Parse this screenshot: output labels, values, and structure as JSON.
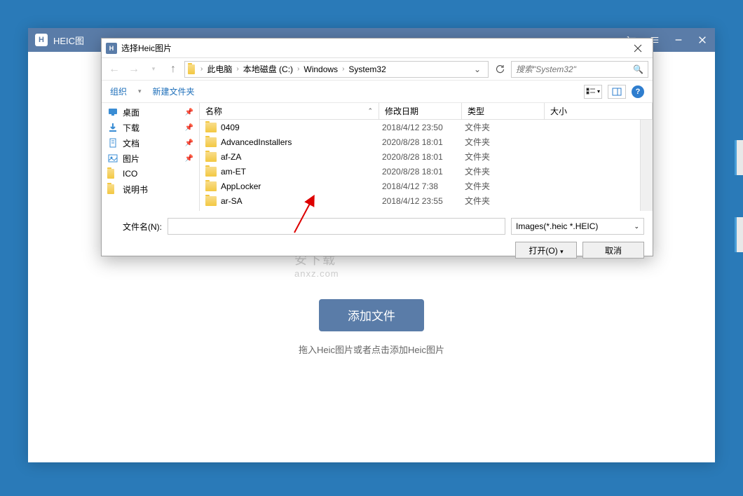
{
  "app": {
    "title": "HEIC图",
    "add_button": "添加文件",
    "hint": "拖入Heic图片或者点击添加Heic图片"
  },
  "watermark": {
    "text": "安下载",
    "url": "anxz.com"
  },
  "dialog": {
    "title": "选择Heic图片",
    "breadcrumb": [
      "此电脑",
      "本地磁盘 (C:)",
      "Windows",
      "System32"
    ],
    "search_placeholder": "搜索\"System32\"",
    "toolbar": {
      "organize": "组织",
      "new_folder": "新建文件夹"
    },
    "sidebar": [
      {
        "icon": "desktop",
        "label": "桌面",
        "pinned": true
      },
      {
        "icon": "download",
        "label": "下载",
        "pinned": true
      },
      {
        "icon": "document",
        "label": "文档",
        "pinned": true
      },
      {
        "icon": "picture",
        "label": "图片",
        "pinned": true
      },
      {
        "icon": "folder",
        "label": "ICO",
        "pinned": false
      },
      {
        "icon": "folder",
        "label": "说明书",
        "pinned": false
      }
    ],
    "columns": {
      "name": "名称",
      "date": "修改日期",
      "type": "类型",
      "size": "大小"
    },
    "files": [
      {
        "name": "0409",
        "date": "2018/4/12 23:50",
        "type": "文件夹"
      },
      {
        "name": "AdvancedInstallers",
        "date": "2020/8/28 18:01",
        "type": "文件夹"
      },
      {
        "name": "af-ZA",
        "date": "2020/8/28 18:01",
        "type": "文件夹"
      },
      {
        "name": "am-ET",
        "date": "2020/8/28 18:01",
        "type": "文件夹"
      },
      {
        "name": "AppLocker",
        "date": "2018/4/12 7:38",
        "type": "文件夹"
      },
      {
        "name": "ar-SA",
        "date": "2018/4/12 23:55",
        "type": "文件夹"
      }
    ],
    "filename_label": "文件名(N):",
    "filename_value": "",
    "filter": "Images(*.heic *.HEIC)",
    "open_btn": "打开(O)",
    "cancel_btn": "取消"
  }
}
